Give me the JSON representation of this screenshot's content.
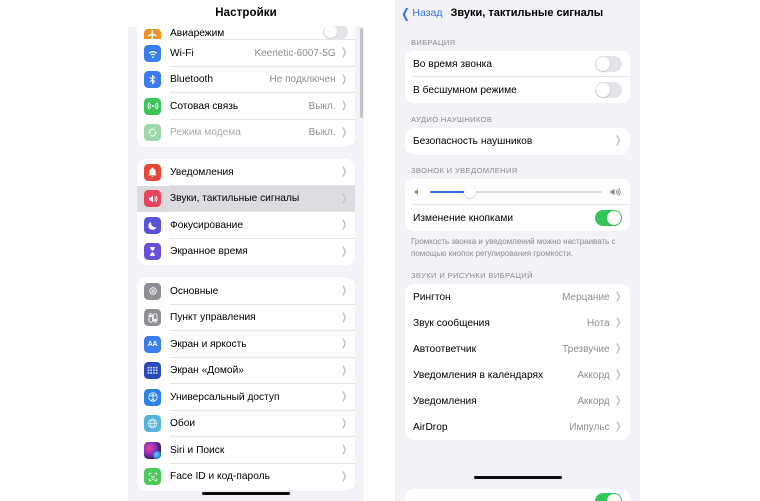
{
  "left_panel": {
    "nav_title": "Настройки",
    "groups": [
      {
        "name": "connectivity",
        "rows": [
          {
            "label": "Авиарежим",
            "icon": "airplane-icon",
            "icon_color": "#f09125",
            "control": "toggle-off",
            "clipped": true
          },
          {
            "label": "Wi-Fi",
            "icon": "wifi-icon",
            "icon_color": "#3a7ded",
            "value": "Keenetic-6007-5G",
            "control": "chevron"
          },
          {
            "label": "Bluetooth",
            "icon": "bluetooth-icon",
            "icon_color": "#3a7ded",
            "value": "Не подключен",
            "control": "chevron"
          },
          {
            "label": "Сотовая связь",
            "icon": "cellular-icon",
            "icon_color": "#3cc45b",
            "value": "Выкл.",
            "control": "chevron"
          },
          {
            "label": "Режим модема",
            "icon": "hotspot-icon",
            "icon_color": "#9fd8ac",
            "value": "Выкл.",
            "control": "chevron",
            "dim": true
          }
        ]
      },
      {
        "name": "alerts",
        "rows": [
          {
            "label": "Уведомления",
            "icon": "bell-icon",
            "icon_color": "#e9463a",
            "control": "chevron"
          },
          {
            "label": "Звуки, тактильные сигналы",
            "icon": "speaker-icon",
            "icon_color": "#e8465c",
            "control": "chevron",
            "selected": true
          },
          {
            "label": "Фокусирование",
            "icon": "moon-icon",
            "icon_color": "#5a55d8",
            "control": "chevron"
          },
          {
            "label": "Экранное время",
            "icon": "hourglass-icon",
            "icon_color": "#6a4fd8",
            "control": "chevron"
          }
        ]
      },
      {
        "name": "system",
        "rows": [
          {
            "label": "Основные",
            "icon": "gear-icon",
            "icon_color": "#8e8e93",
            "control": "chevron"
          },
          {
            "label": "Пункт управления",
            "icon": "control-center-icon",
            "icon_color": "#8e8e93",
            "control": "chevron"
          },
          {
            "label": "Экран и яркость",
            "icon": "display-aa-icon",
            "icon_color": "#3a7ded",
            "control": "chevron"
          },
          {
            "label": "Экран «Домой»",
            "icon": "home-screen-icon",
            "icon_color": "#2a49b8",
            "control": "chevron"
          },
          {
            "label": "Универсальный доступ",
            "icon": "accessibility-icon",
            "icon_color": "#2d82e8",
            "control": "chevron"
          },
          {
            "label": "Обои",
            "icon": "wallpaper-icon",
            "icon_color": "#53b6da",
            "control": "chevron"
          },
          {
            "label": "Siri и Поиск",
            "icon": "siri-icon",
            "icon_color": "#3f2a6e",
            "control": "chevron"
          },
          {
            "label": "Face ID и код-пароль",
            "icon": "face-id-icon",
            "icon_color": "#4cc85d",
            "control": "chevron"
          }
        ]
      }
    ]
  },
  "right_panel": {
    "back_label": "Назад",
    "page_title": "Звуки, тактильные сигналы",
    "sections": [
      {
        "header": "ВИБРАЦИЯ",
        "rows": [
          {
            "label": "Во время звонка",
            "control": "toggle",
            "toggle_on": false
          },
          {
            "label": "В бесшумном режиме",
            "control": "toggle",
            "toggle_on": false
          }
        ]
      },
      {
        "header": "АУДИО НАУШНИКОВ",
        "rows": [
          {
            "label": "Безопасность наушников",
            "control": "chevron"
          }
        ]
      },
      {
        "header": "ЗВОНОК И УВЕДОМЛЕНИЯ",
        "rows": [
          {
            "label": "",
            "control": "slider",
            "slider_percent": 23
          },
          {
            "label": "Изменение кнопками",
            "control": "toggle",
            "toggle_on": true
          }
        ],
        "footer": "Громкость звонка и уведомлений можно настраивать с помощью кнопок регулирования громкости."
      },
      {
        "header": "ЗВУКИ И РИСУНКИ ВИБРАЦИЙ",
        "rows": [
          {
            "label": "Рингтон",
            "value": "Мерцание",
            "control": "chevron"
          },
          {
            "label": "Звук сообщения",
            "value": "Нота",
            "control": "chevron"
          },
          {
            "label": "Автоответчик",
            "value": "Трезвучие",
            "control": "chevron"
          },
          {
            "label": "Уведомления в календарях",
            "value": "Аккорд",
            "control": "chevron"
          },
          {
            "label": "Уведомления",
            "value": "Аккорд",
            "control": "chevron"
          },
          {
            "label": "AirDrop",
            "value": "Импульс",
            "control": "chevron"
          }
        ]
      }
    ]
  },
  "colors": {
    "accent_blue": "#3174f0",
    "toggle_green": "#34c759",
    "slider_blue": "#2f6fe0",
    "panel_bg": "#f2f2f7",
    "card_bg": "#ffffff",
    "secondary_text": "#8e8e93",
    "selected_row": "#dcdce0"
  }
}
